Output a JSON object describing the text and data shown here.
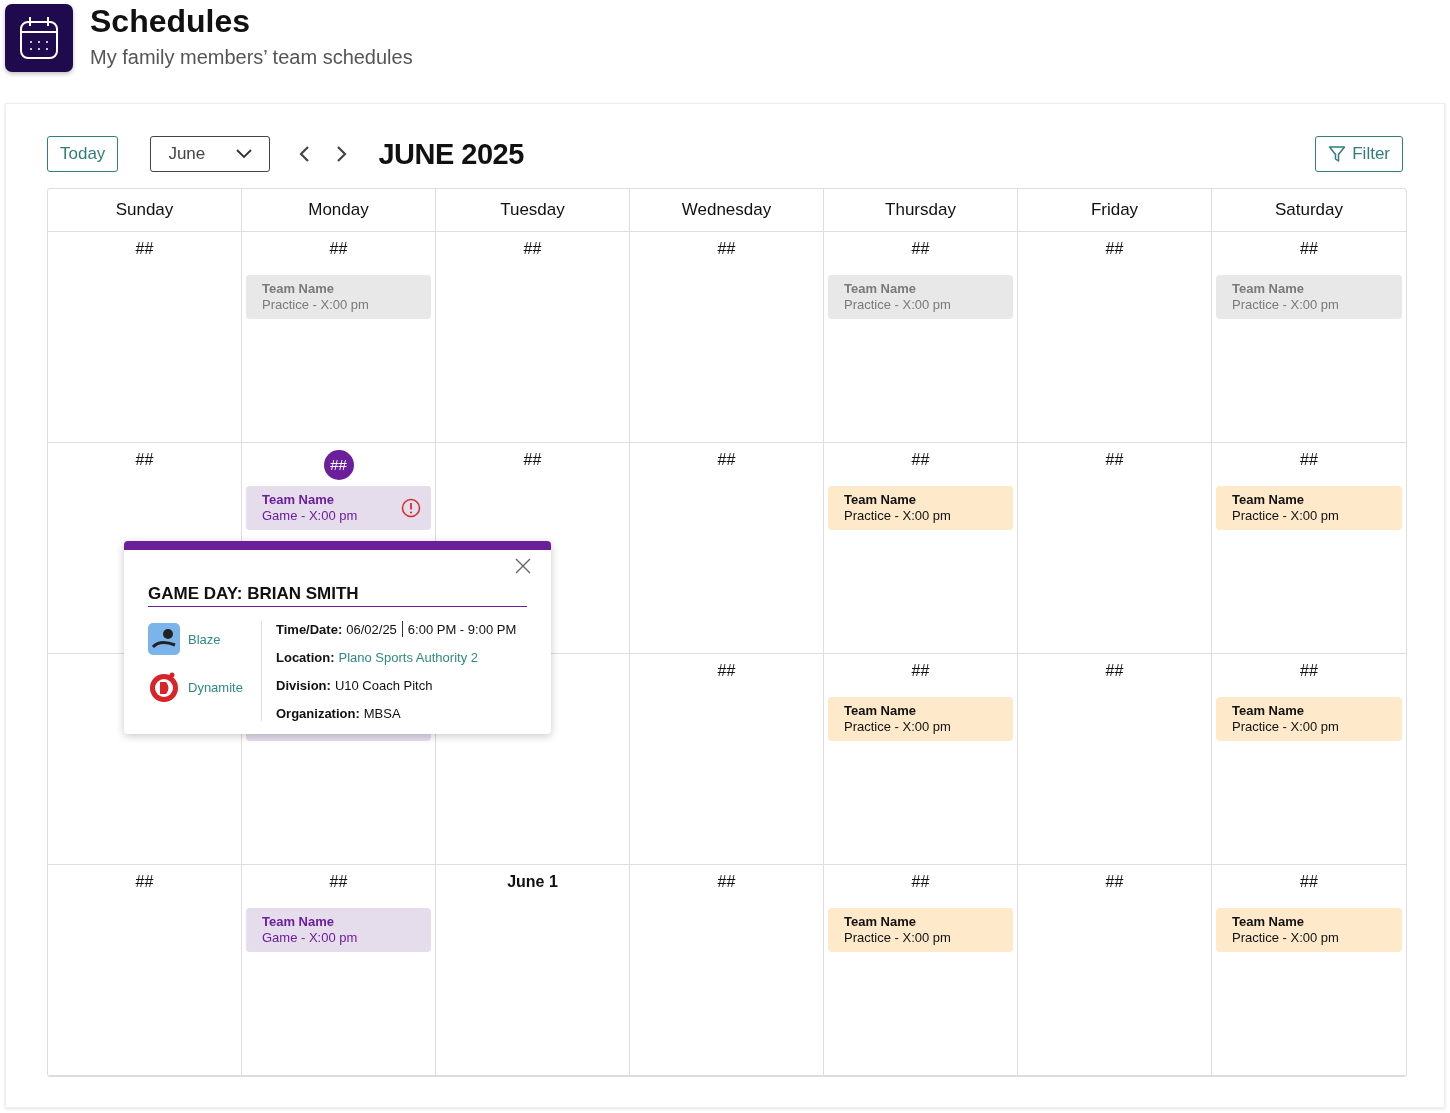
{
  "header": {
    "title": "Schedules",
    "subtitle": "My family members’ team schedules"
  },
  "toolbar": {
    "today_button": "Today",
    "month_select": "June",
    "month_title": "JUNE 2025",
    "filter_button": "Filter"
  },
  "weekdays": [
    "Sunday",
    "Monday",
    "Tuesday",
    "Wednesday",
    "Thursday",
    "Friday",
    "Saturday"
  ],
  "weeks": [
    {
      "days": [
        {
          "kind": "day",
          "day": "##",
          "today": false,
          "month_start": false
        },
        {
          "kind": "day",
          "day": "##",
          "today": false,
          "month_start": false,
          "events": [
            {
              "kind": "past",
              "team": "Team Name",
              "detail": "Practice - X:00 pm",
              "alert": false
            }
          ]
        },
        {
          "kind": "day",
          "day": "##",
          "today": false,
          "month_start": false
        },
        {
          "kind": "day",
          "day": "##",
          "today": false,
          "month_start": false
        },
        {
          "kind": "day",
          "day": "##",
          "today": false,
          "month_start": false,
          "events": [
            {
              "kind": "past",
              "team": "Team Name",
              "detail": "Practice - X:00 pm",
              "alert": false
            }
          ]
        },
        {
          "kind": "day",
          "day": "##",
          "today": false,
          "month_start": false
        },
        {
          "kind": "day",
          "day": "##",
          "today": false,
          "month_start": false,
          "events": [
            {
              "kind": "past",
              "team": "Team Name",
              "detail": "Practice - X:00 pm",
              "alert": false
            }
          ]
        }
      ]
    },
    {
      "days": [
        {
          "kind": "day",
          "day": "##",
          "today": false,
          "month_start": false
        },
        {
          "kind": "day",
          "day": "##",
          "today": true,
          "month_start": false,
          "events": [
            {
              "kind": "game",
              "team": "Team Name",
              "detail": "Game - X:00 pm",
              "alert": true
            }
          ]
        },
        {
          "kind": "day",
          "day": "##",
          "today": false,
          "month_start": false
        },
        {
          "kind": "day",
          "day": "##",
          "today": false,
          "month_start": false
        },
        {
          "kind": "day",
          "day": "##",
          "today": false,
          "month_start": false,
          "events": [
            {
              "kind": "practice",
              "team": "Team Name",
              "detail": "Practice - X:00 pm",
              "alert": false
            }
          ]
        },
        {
          "kind": "day",
          "day": "##",
          "today": false,
          "month_start": false
        },
        {
          "kind": "day",
          "day": "##",
          "today": false,
          "month_start": false,
          "events": [
            {
              "kind": "practice",
              "team": "Team Name",
              "detail": "Practice - X:00 pm",
              "alert": false
            }
          ]
        }
      ]
    },
    {
      "days": [
        {
          "kind": "covered"
        },
        {
          "kind": "covered",
          "events": [
            {
              "kind": "game"
            }
          ]
        },
        {
          "kind": "covered"
        },
        {
          "kind": "day",
          "day": "##",
          "today": false,
          "month_start": false
        },
        {
          "kind": "day",
          "day": "##",
          "today": false,
          "month_start": false,
          "events": [
            {
              "kind": "practice",
              "team": "Team Name",
              "detail": "Practice - X:00 pm",
              "alert": false
            }
          ]
        },
        {
          "kind": "day",
          "day": "##",
          "today": false,
          "month_start": false
        },
        {
          "kind": "day",
          "day": "##",
          "today": false,
          "month_start": false,
          "events": [
            {
              "kind": "practice",
              "team": "Team Name",
              "detail": "Practice - X:00 pm",
              "alert": false
            }
          ]
        }
      ]
    },
    {
      "days": [
        {
          "kind": "day",
          "day": "##",
          "today": false,
          "month_start": false
        },
        {
          "kind": "day",
          "day": "##",
          "today": false,
          "month_start": false,
          "events": [
            {
              "kind": "game",
              "team": "Team Name",
              "detail": "Game - X:00 pm",
              "alert": false
            }
          ]
        },
        {
          "kind": "day",
          "day": "June 1",
          "today": false,
          "month_start": true
        },
        {
          "kind": "day",
          "day": "##",
          "today": false,
          "month_start": false
        },
        {
          "kind": "day",
          "day": "##",
          "today": false,
          "month_start": false,
          "events": [
            {
              "kind": "practice",
              "team": "Team Name",
              "detail": "Practice - X:00 pm",
              "alert": false
            }
          ]
        },
        {
          "kind": "day",
          "day": "##",
          "today": false,
          "month_start": false
        },
        {
          "kind": "day",
          "day": "##",
          "today": false,
          "month_start": false,
          "events": [
            {
              "kind": "practice",
              "team": "Team Name",
              "detail": "Practice - X:00 pm",
              "alert": false
            }
          ]
        }
      ]
    }
  ],
  "popup": {
    "title": "GAME DAY: BRIAN SMITH",
    "teams": [
      {
        "name": "Blaze",
        "kind": "blaze"
      },
      {
        "name": "Dynamite",
        "kind": "dynamite"
      }
    ],
    "details": [
      {
        "label": "Time/Date:",
        "value": "06/02/25",
        "extra": "6:00 PM - 9:00 PM",
        "kind": "text"
      },
      {
        "label": "Location:",
        "value": "Plano Sports Authority 2",
        "kind": "link"
      },
      {
        "label": "Division:",
        "value": "U10 Coach Pitch",
        "kind": "text"
      },
      {
        "label": "Organization:",
        "value": "MBSA",
        "kind": "text"
      }
    ]
  }
}
